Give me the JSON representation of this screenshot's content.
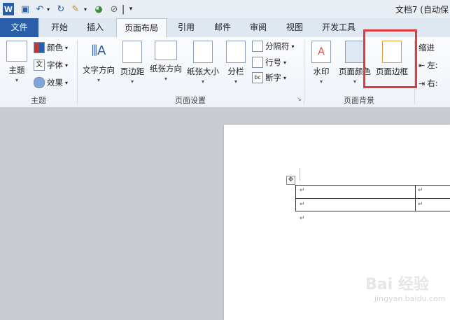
{
  "title_bar": {
    "doc_title": "文档7 (自动保"
  },
  "tabs": [
    {
      "label": "文件"
    },
    {
      "label": "开始"
    },
    {
      "label": "插入"
    },
    {
      "label": "页面布局"
    },
    {
      "label": "引用"
    },
    {
      "label": "邮件"
    },
    {
      "label": "审阅"
    },
    {
      "label": "视图"
    },
    {
      "label": "开发工具"
    }
  ],
  "ribbon": {
    "groups": {
      "theme": "主题",
      "page_setup": "页面设置",
      "page_background": "页面背景"
    },
    "theme": {
      "main": "主题",
      "colors": "颜色",
      "fonts": "字体",
      "effects": "效果"
    },
    "page_setup": {
      "text_direction": "文字方向",
      "margins": "页边距",
      "orientation": "纸张方向",
      "size": "纸张大小",
      "columns": "分栏",
      "breaks": "分隔符",
      "line_numbers": "行号",
      "hyphenation": "断字"
    },
    "page_background": {
      "watermark": "水印",
      "page_color": "页面颜色",
      "page_borders": "页面边框"
    },
    "paragraph": {
      "indent": "缩进",
      "left": "左:",
      "right": "右:"
    }
  },
  "watermark": {
    "brand": "Bai 经验",
    "url": "jingyan.baidu.com"
  },
  "colors": {
    "file_tab": "#2a5ea8",
    "highlight": "#e33b3b"
  }
}
